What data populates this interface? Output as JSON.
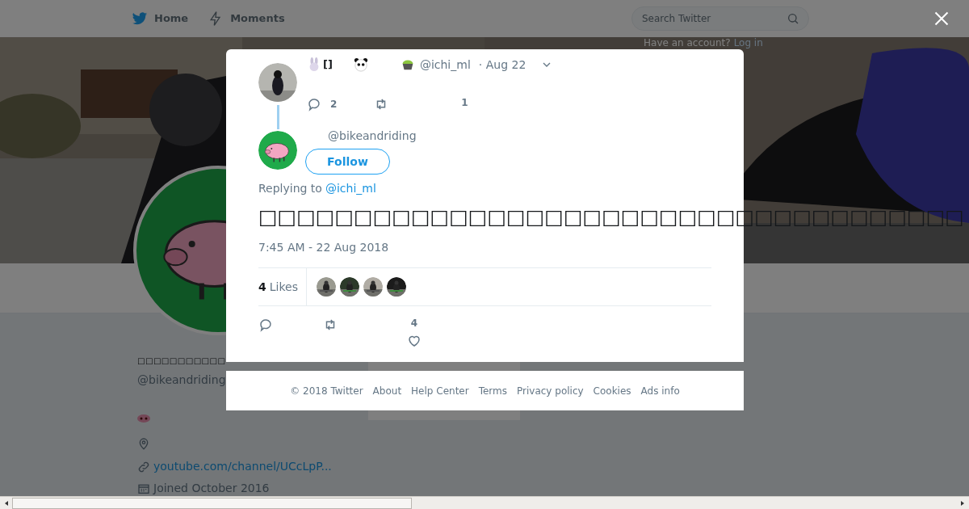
{
  "nav": [
    {
      "label": "Home",
      "kind": "bird"
    },
    {
      "label": "Moments",
      "kind": "bolt"
    }
  ],
  "search": {
    "placeholder": "Search Twitter"
  },
  "login_prompt": {
    "text": "Have an account?",
    "link": "Log in"
  },
  "profile": {
    "name": "□□□□□□□□□□□",
    "handle": "@bikeandriding",
    "link": "youtube.com/channel/UCcLpP...",
    "joined": "Joined October 2016"
  },
  "parent_tweet": {
    "name": "[]",
    "handle": "@ichi_ml",
    "time": "· Aug 22",
    "replies": "2",
    "likes": "1"
  },
  "reply": {
    "handle": "@bikeandriding",
    "follow": "Follow",
    "replying_to": "Replying to",
    "replying_handle": "@ichi_ml",
    "text": "□□□□□□□□□□□□□□□□□□□□□□□□□□□□□□□□□□□□□",
    "timestamp": "7:45 AM - 22 Aug 2018",
    "likes_count": "4",
    "likes_label": "Likes",
    "like_total": "4"
  },
  "footer": [
    "© 2018 Twitter",
    "About",
    "Help Center",
    "Terms",
    "Privacy policy",
    "Cookies",
    "Ads info"
  ]
}
